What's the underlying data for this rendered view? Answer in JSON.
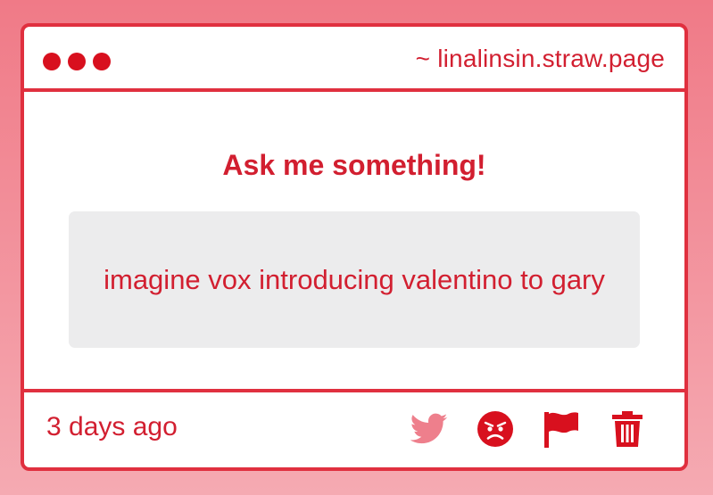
{
  "window": {
    "url": "~ linalinsin.straw.page"
  },
  "prompt": {
    "title": "Ask me something!"
  },
  "question": {
    "text": "imagine vox introducing valentino to gary"
  },
  "footer": {
    "timestamp": "3 days ago",
    "actions": [
      {
        "icon": "twitter-icon",
        "color": "#ee7f8c"
      },
      {
        "icon": "angry-face-icon",
        "color": "#d8101e"
      },
      {
        "icon": "flag-icon",
        "color": "#d8101e"
      },
      {
        "icon": "trash-icon",
        "color": "#d8101e"
      }
    ]
  },
  "colors": {
    "accent": "#d8101e",
    "border": "#e0303f",
    "question_bg": "#ececed",
    "background_top": "#f07a87",
    "background_bottom": "#f5aab2"
  }
}
